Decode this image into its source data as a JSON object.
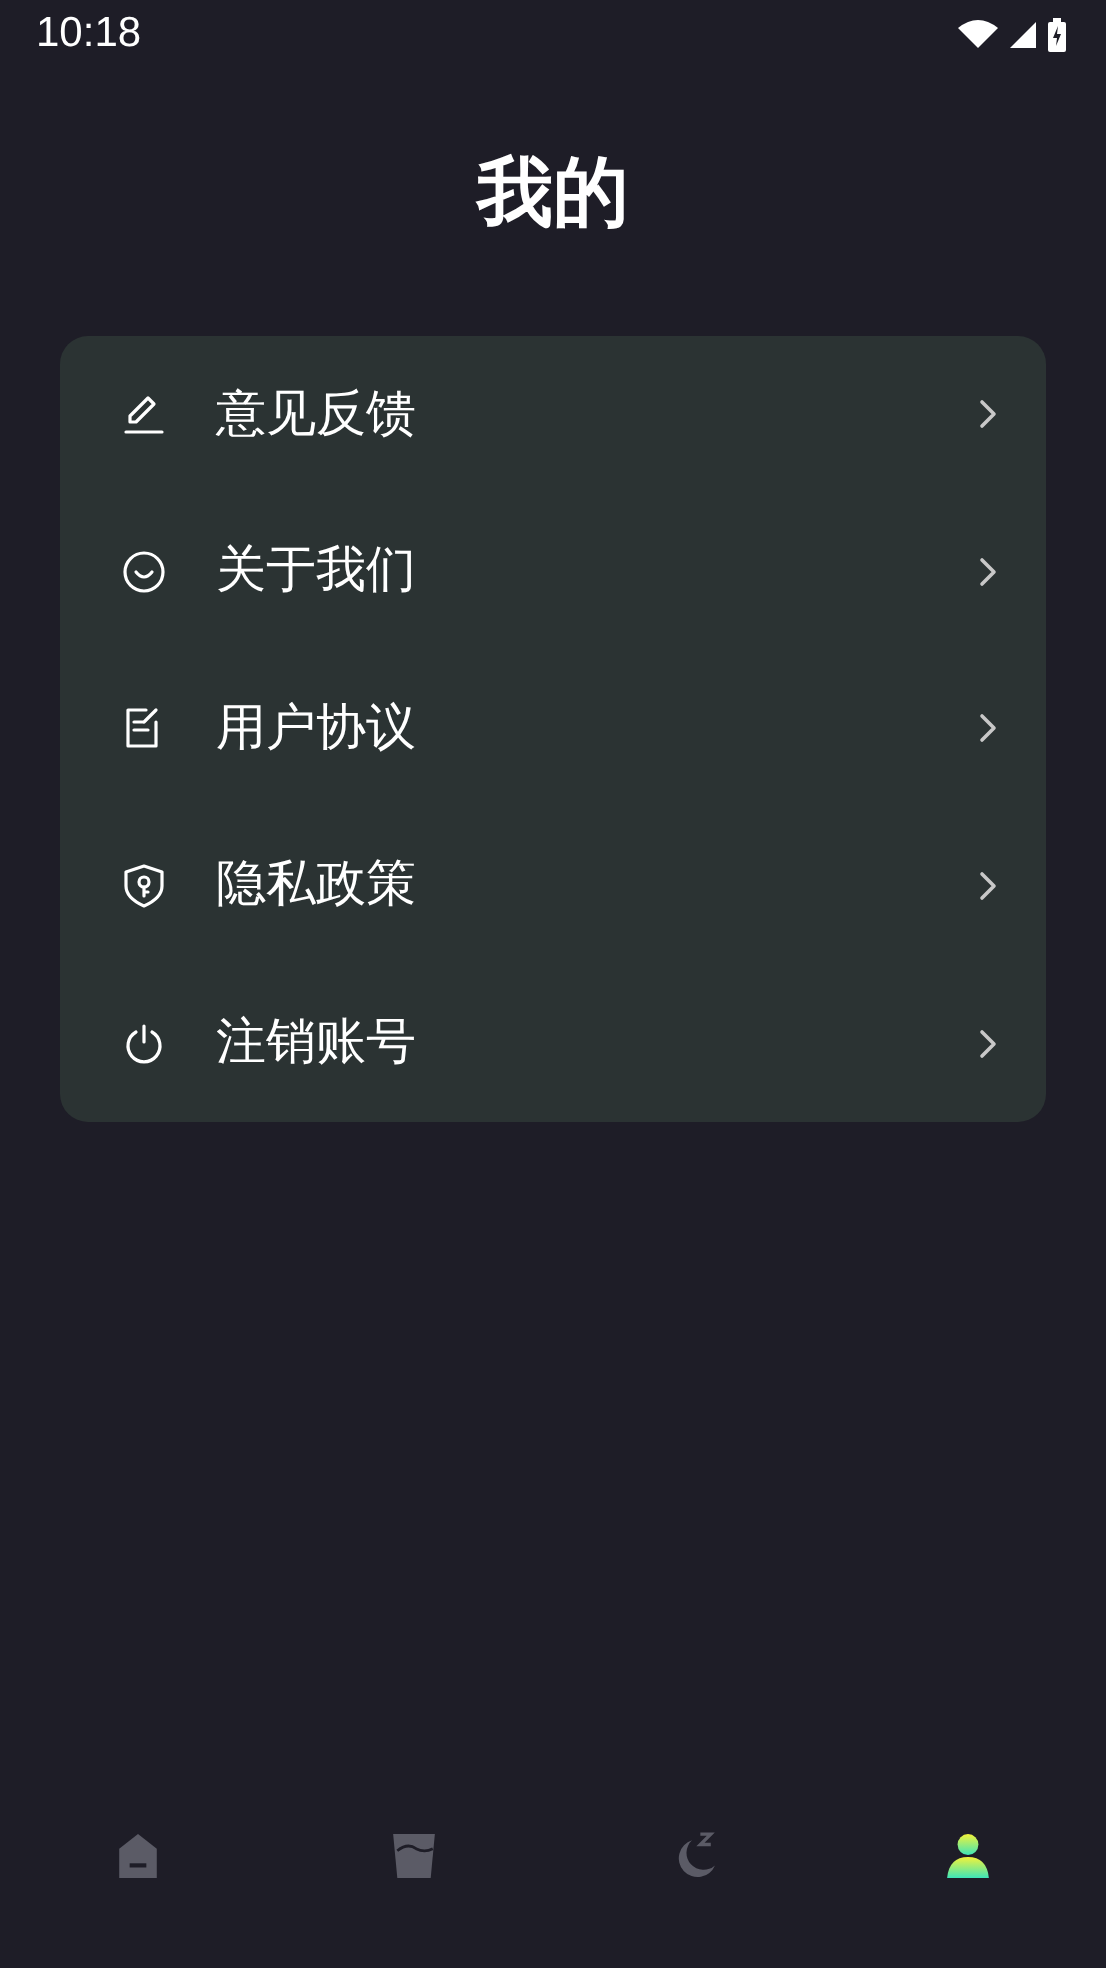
{
  "status_bar": {
    "time": "10:18"
  },
  "title": "我的",
  "menu": [
    {
      "label": "意见反馈"
    },
    {
      "label": "关于我们"
    },
    {
      "label": "用户协议"
    },
    {
      "label": "隐私政策"
    },
    {
      "label": "注销账号"
    }
  ],
  "bottom_nav": [
    {
      "selected": false
    },
    {
      "selected": false
    },
    {
      "selected": false
    },
    {
      "selected": true
    }
  ]
}
